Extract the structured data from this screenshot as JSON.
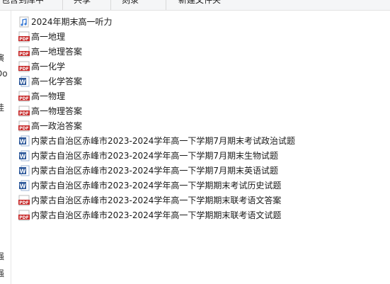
{
  "toolbar": {
    "items": [
      {
        "label": "包含到库中"
      },
      {
        "label": "共享"
      },
      {
        "label": "刻录"
      },
      {
        "label": "新建文件夹"
      }
    ]
  },
  "left_pane": {
    "fragments": [
      "演",
      "Do",
      "娃",
      "强",
      "强"
    ]
  },
  "files": [
    {
      "name": "2024年期末高一听力",
      "icon": "audio-file-icon"
    },
    {
      "name": "高一地理",
      "icon": "pdf-file-icon"
    },
    {
      "name": "高一地理答案",
      "icon": "pdf-file-icon"
    },
    {
      "name": "高一化学",
      "icon": "pdf-file-icon"
    },
    {
      "name": "高一化学答案",
      "icon": "word-file-icon"
    },
    {
      "name": "高一物理",
      "icon": "pdf-file-icon"
    },
    {
      "name": "高一物理答案",
      "icon": "pdf-file-icon"
    },
    {
      "name": "高一政治答案",
      "icon": "pdf-file-icon"
    },
    {
      "name": "内蒙古自治区赤峰市2023-2024学年高一下学期7月期末考试政治试题",
      "icon": "word-file-icon"
    },
    {
      "name": "内蒙古自治区赤峰市2023-2024学年高一下学期7月期末生物试题",
      "icon": "word-file-icon"
    },
    {
      "name": "内蒙古自治区赤峰市2023-2024学年高一下学期7月期末英语试题",
      "icon": "word-file-icon"
    },
    {
      "name": "内蒙古自治区赤峰市2023-2024学年高一下学期期末考试历史试题",
      "icon": "word-file-icon"
    },
    {
      "name": "内蒙古自治区赤峰市2023-2024学年高一下学期期末联考语文答案",
      "icon": "pdf-file-icon"
    },
    {
      "name": "内蒙古自治区赤峰市2023-2024学年高一下学期期末联考语文试题",
      "icon": "pdf-file-icon"
    }
  ],
  "colors": {
    "pdf": "#c62828",
    "word": "#2b579a",
    "audio": "#3a7bd5"
  }
}
